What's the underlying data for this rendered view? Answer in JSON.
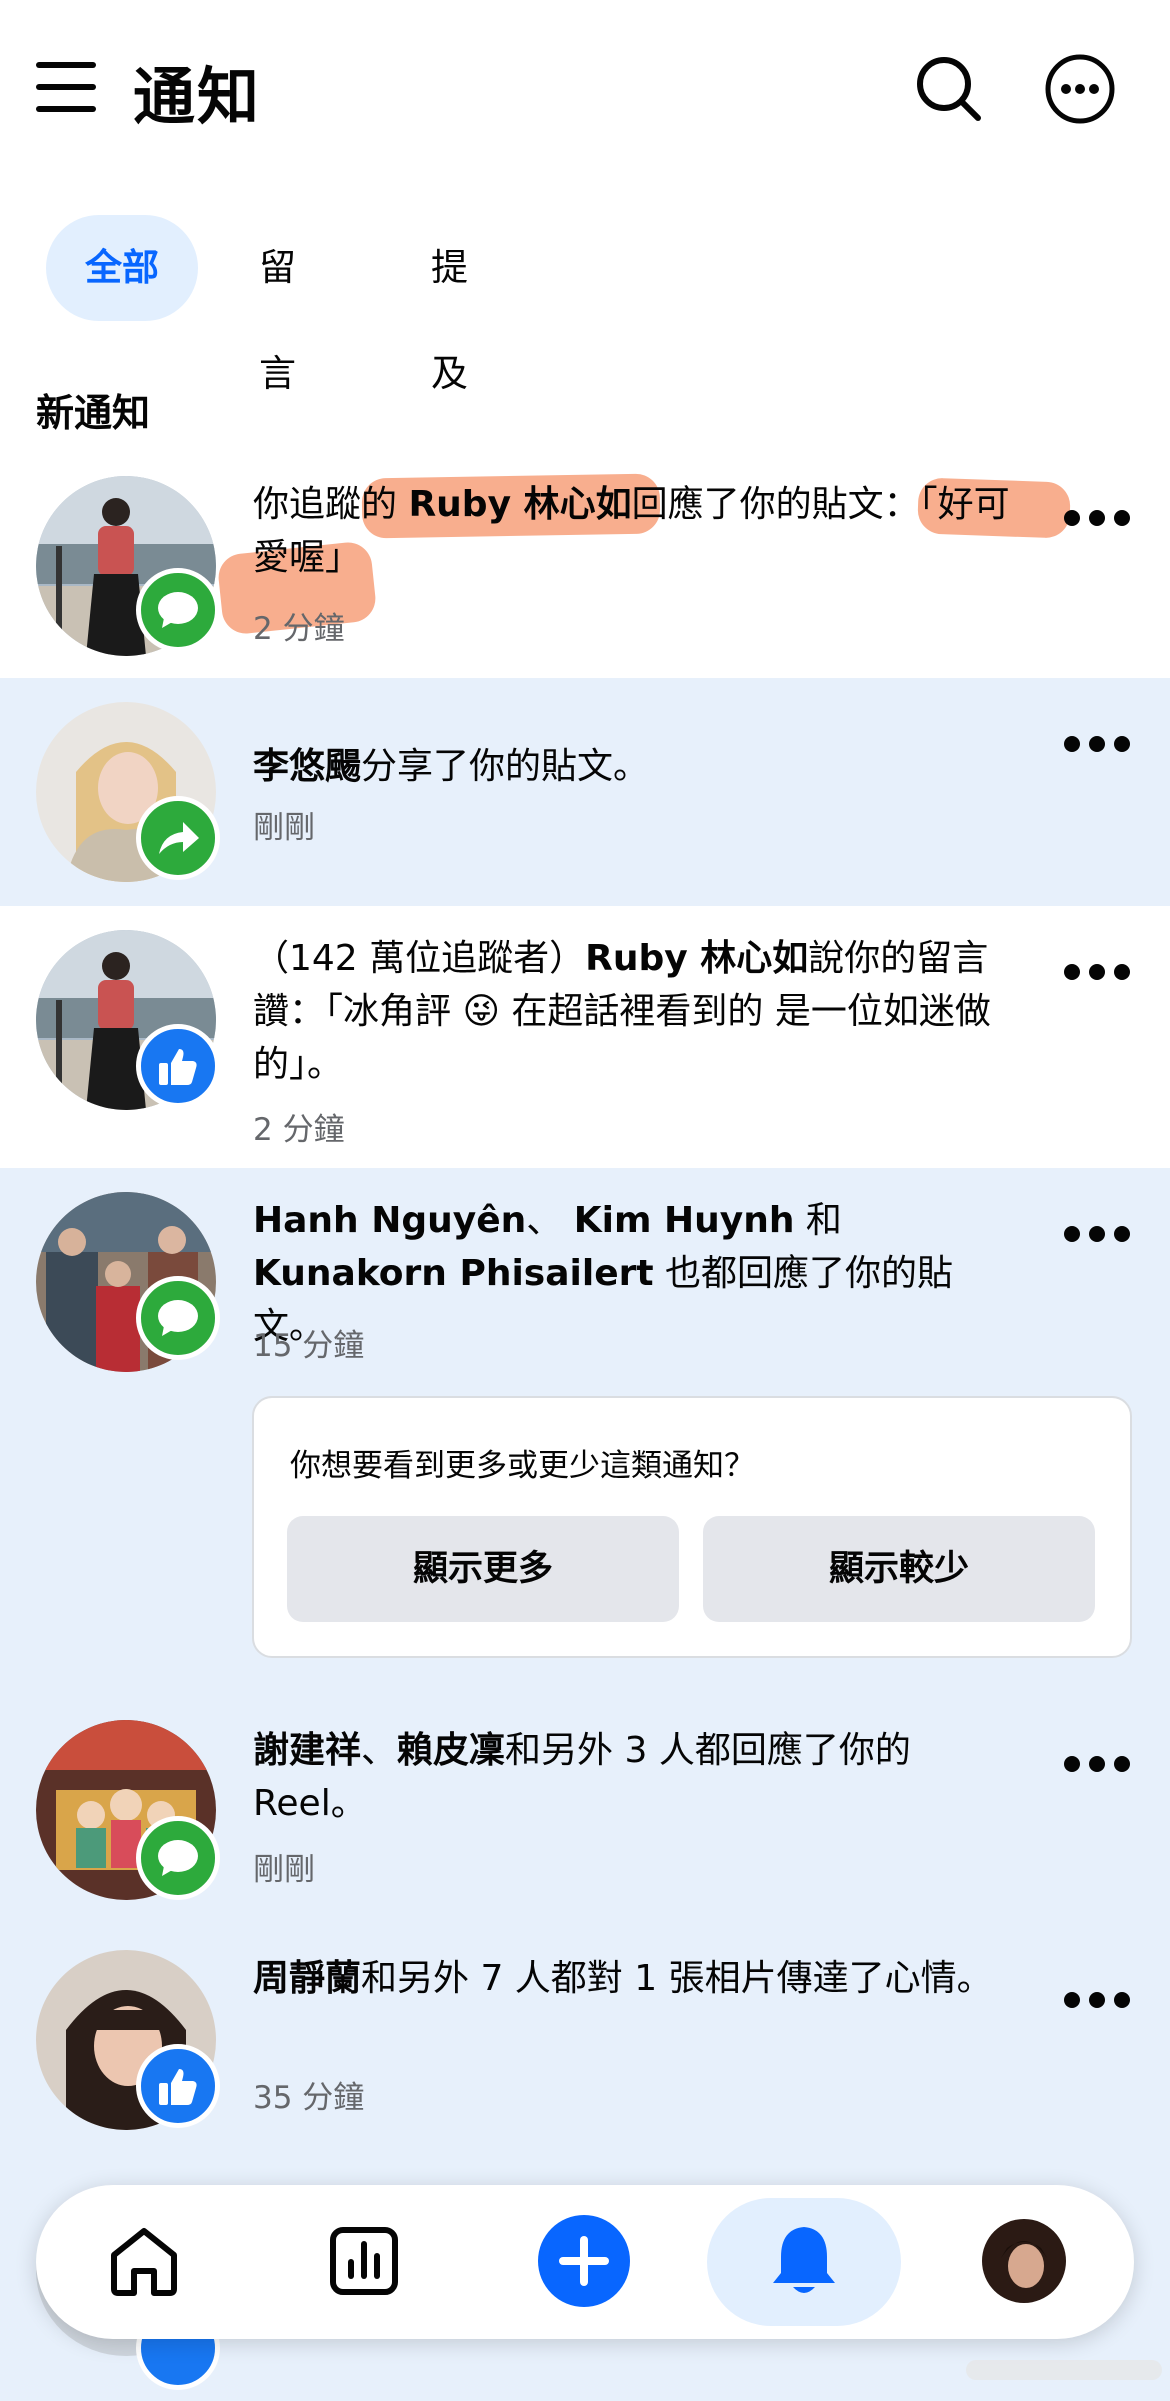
{
  "header": {
    "title": "通知"
  },
  "tabs": [
    {
      "label": "全部",
      "active": true
    },
    {
      "label": "留言",
      "active": false
    },
    {
      "label": "提及",
      "active": false
    }
  ],
  "section": {
    "title": "新通知"
  },
  "notifications": [
    {
      "parts": [
        "你追蹤的 ",
        "Ruby 林心如",
        "回應了你的貼文：「好可愛喔」"
      ],
      "time": "2 分鐘",
      "badge_icon": "comment-icon",
      "badge_color": "#2daa3c",
      "unread": false
    },
    {
      "parts": [
        "李悠颺",
        "分享了你的貼文。"
      ],
      "time": "剛剛",
      "badge_icon": "share-icon",
      "badge_color": "#2daa3c",
      "unread": true
    },
    {
      "parts": [
        "（142 萬位追蹤者）",
        "Ruby 林心如",
        "說你的留言讚：「冰角評 😜 在超話裡看到的 是一位如迷做的」。"
      ],
      "time": "2 分鐘",
      "badge_icon": "like-icon",
      "badge_color": "#1877f2",
      "unread": false
    },
    {
      "parts": [
        "Hanh Nguyên",
        "、 ",
        "Kim Huynh",
        " 和 ",
        "Kunakorn Phisailert",
        " 也都回應了你的貼文。"
      ],
      "time": "15 分鐘",
      "badge_icon": "comment-icon",
      "badge_color": "#2daa3c",
      "unread": true
    },
    {
      "parts": [
        "謝建祥",
        "、",
        "賴皮凜",
        "和另外 3 人都回應了你的 Reel。"
      ],
      "time": "剛剛",
      "badge_icon": "comment-icon",
      "badge_color": "#2daa3c",
      "unread": true
    },
    {
      "parts": [
        "周靜蘭",
        "和另外 7 人都對 1 張相片傳達了心情。"
      ],
      "time": "35 分鐘",
      "badge_icon": "like-icon",
      "badge_color": "#1877f2",
      "unread": true
    }
  ],
  "feedback": {
    "question": "你想要看到更多或更少這類通知？",
    "show_more": "顯示更多",
    "show_less": "顯示較少"
  },
  "bottom_nav": {
    "items": [
      "home-icon",
      "stats-icon",
      "create-icon",
      "notifications-bell-icon",
      "profile-avatar"
    ],
    "active": "notifications-bell-icon"
  },
  "colors": {
    "accent": "#0866ff",
    "unread_bg": "#e7f0fb",
    "highlight": "#f7a07a"
  }
}
